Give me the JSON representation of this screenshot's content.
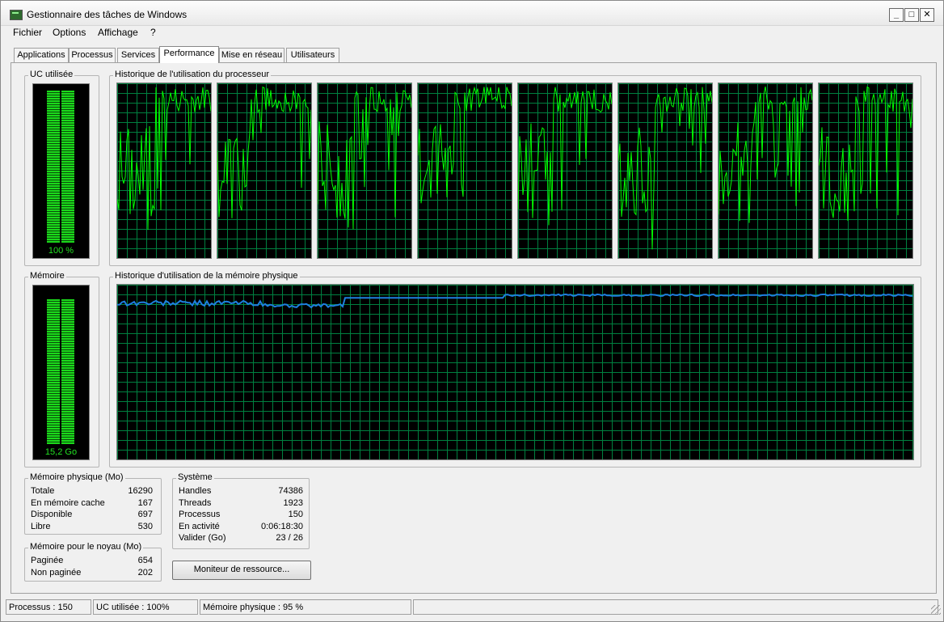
{
  "window": {
    "title": "Gestionnaire des tâches de Windows",
    "icon": "task-manager-icon"
  },
  "window_buttons": [
    "minimize",
    "maximize",
    "close"
  ],
  "menu": [
    "Fichier",
    "Options",
    "Affichage",
    "?"
  ],
  "tabs": [
    {
      "label": "Applications",
      "active": false
    },
    {
      "label": "Processus",
      "active": false
    },
    {
      "label": "Services",
      "active": false
    },
    {
      "label": "Performance",
      "active": true
    },
    {
      "label": "Mise en réseau",
      "active": false
    },
    {
      "label": "Utilisateurs",
      "active": false
    }
  ],
  "cpu": {
    "group_label": "UC utilisée",
    "value_label": "100 %",
    "level": 1.0
  },
  "cpu_history": {
    "group_label": "Historique de l'utilisation du processeur",
    "cores": 8,
    "line_color": "#00ff00"
  },
  "memory": {
    "group_label": "Mémoire",
    "value_label": "15,2 Go",
    "level": 0.95
  },
  "memory_history": {
    "group_label": "Historique d'utilisation de la mémoire physique",
    "line_color": "#1e7fe0"
  },
  "physical_memory": {
    "group_label": "Mémoire physique (Mo)",
    "rows": [
      {
        "name": "Totale",
        "value": "16290"
      },
      {
        "name": "En mémoire cache",
        "value": "167"
      },
      {
        "name": "Disponible",
        "value": "697"
      },
      {
        "name": "Libre",
        "value": "530"
      }
    ]
  },
  "kernel_memory": {
    "group_label": "Mémoire pour le noyau (Mo)",
    "rows": [
      {
        "name": "Paginée",
        "value": "654"
      },
      {
        "name": "Non paginée",
        "value": "202"
      }
    ]
  },
  "system": {
    "group_label": "Système",
    "rows": [
      {
        "name": "Handles",
        "value": "74386"
      },
      {
        "name": "Threads",
        "value": "1923"
      },
      {
        "name": "Processus",
        "value": "150"
      },
      {
        "name": "En activité",
        "value": "0:06:18:30"
      },
      {
        "name": "Valider (Go)",
        "value": "23 / 26"
      }
    ]
  },
  "resource_monitor_button": "Moniteur de ressource...",
  "statusbar": {
    "processes": "Processus : 150",
    "cpu": "UC utilisée : 100%",
    "memory": "Mémoire physique : 95 %"
  },
  "colors": {
    "graph_grid": "#008040",
    "meter_green": "#1bd91b",
    "background": "#f0f0f0"
  }
}
